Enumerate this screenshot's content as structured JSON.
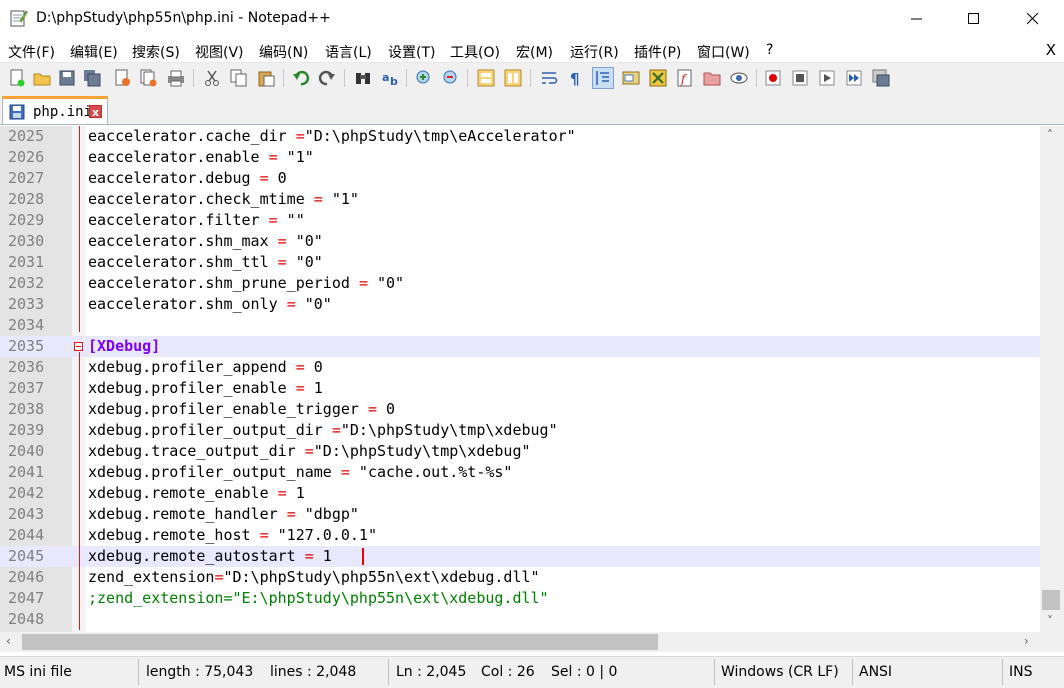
{
  "window": {
    "title": "D:\\phpStudy\\php55n\\php.ini - Notepad++"
  },
  "menu": {
    "items": [
      "文件(F)",
      "编辑(E)",
      "搜索(S)",
      "视图(V)",
      "编码(N)",
      "语言(L)",
      "设置(T)",
      "工具(O)",
      "宏(M)",
      "运行(R)",
      "插件(P)",
      "窗口(W)",
      "?"
    ],
    "close_label": "X"
  },
  "tab": {
    "label": "php.ini",
    "close_label": "x"
  },
  "editor": {
    "lines": [
      {
        "num": "2025",
        "text": "eaccelerator.cache_dir =\"D:\\phpStudy\\tmp\\eAccelerator\""
      },
      {
        "num": "2026",
        "text": "eaccelerator.enable = \"1\""
      },
      {
        "num": "2027",
        "text": "eaccelerator.debug = 0"
      },
      {
        "num": "2028",
        "text": "eaccelerator.check_mtime = \"1\""
      },
      {
        "num": "2029",
        "text": "eaccelerator.filter = \"\""
      },
      {
        "num": "2030",
        "text": "eaccelerator.shm_max = \"0\""
      },
      {
        "num": "2031",
        "text": "eaccelerator.shm_ttl = \"0\""
      },
      {
        "num": "2032",
        "text": "eaccelerator.shm_prune_period = \"0\""
      },
      {
        "num": "2033",
        "text": "eaccelerator.shm_only = \"0\""
      },
      {
        "num": "2034",
        "text": ""
      },
      {
        "num": "2035",
        "text": "[XDebug]"
      },
      {
        "num": "2036",
        "text": "xdebug.profiler_append = 0"
      },
      {
        "num": "2037",
        "text": "xdebug.profiler_enable = 1"
      },
      {
        "num": "2038",
        "text": "xdebug.profiler_enable_trigger = 0"
      },
      {
        "num": "2039",
        "text": "xdebug.profiler_output_dir =\"D:\\phpStudy\\tmp\\xdebug\""
      },
      {
        "num": "2040",
        "text": "xdebug.trace_output_dir =\"D:\\phpStudy\\tmp\\xdebug\""
      },
      {
        "num": "2041",
        "text": "xdebug.profiler_output_name = \"cache.out.%t-%s\""
      },
      {
        "num": "2042",
        "text": "xdebug.remote_enable = 1"
      },
      {
        "num": "2043",
        "text": "xdebug.remote_handler = \"dbgp\""
      },
      {
        "num": "2044",
        "text": "xdebug.remote_host = \"127.0.0.1\""
      },
      {
        "num": "2045",
        "text": "xdebug.remote_autostart = 1"
      },
      {
        "num": "2046",
        "text": "zend_extension=\"D:\\phpStudy\\php55n\\ext\\xdebug.dll\""
      },
      {
        "num": "2047",
        "text": ";zend_extension=\"E:\\phpStudy\\php55n\\ext\\xdebug.dll\""
      },
      {
        "num": "2048",
        "text": ""
      }
    ],
    "caret_line": "2045"
  },
  "status": {
    "file_type": "MS ini file",
    "length": "length : 75,043",
    "lines": "lines : 2,048",
    "ln": "Ln : 2,045",
    "col": "Col : 26",
    "sel": "Sel : 0 | 0",
    "eol": "Windows (CR LF)",
    "encoding": "ANSI",
    "mode": "INS"
  },
  "colors": {
    "section": "#8000ff",
    "comment": "#008000",
    "operator": "#e00000",
    "caret_line_bg": "#e8e8ff",
    "tab_accent": "#f9a235"
  }
}
